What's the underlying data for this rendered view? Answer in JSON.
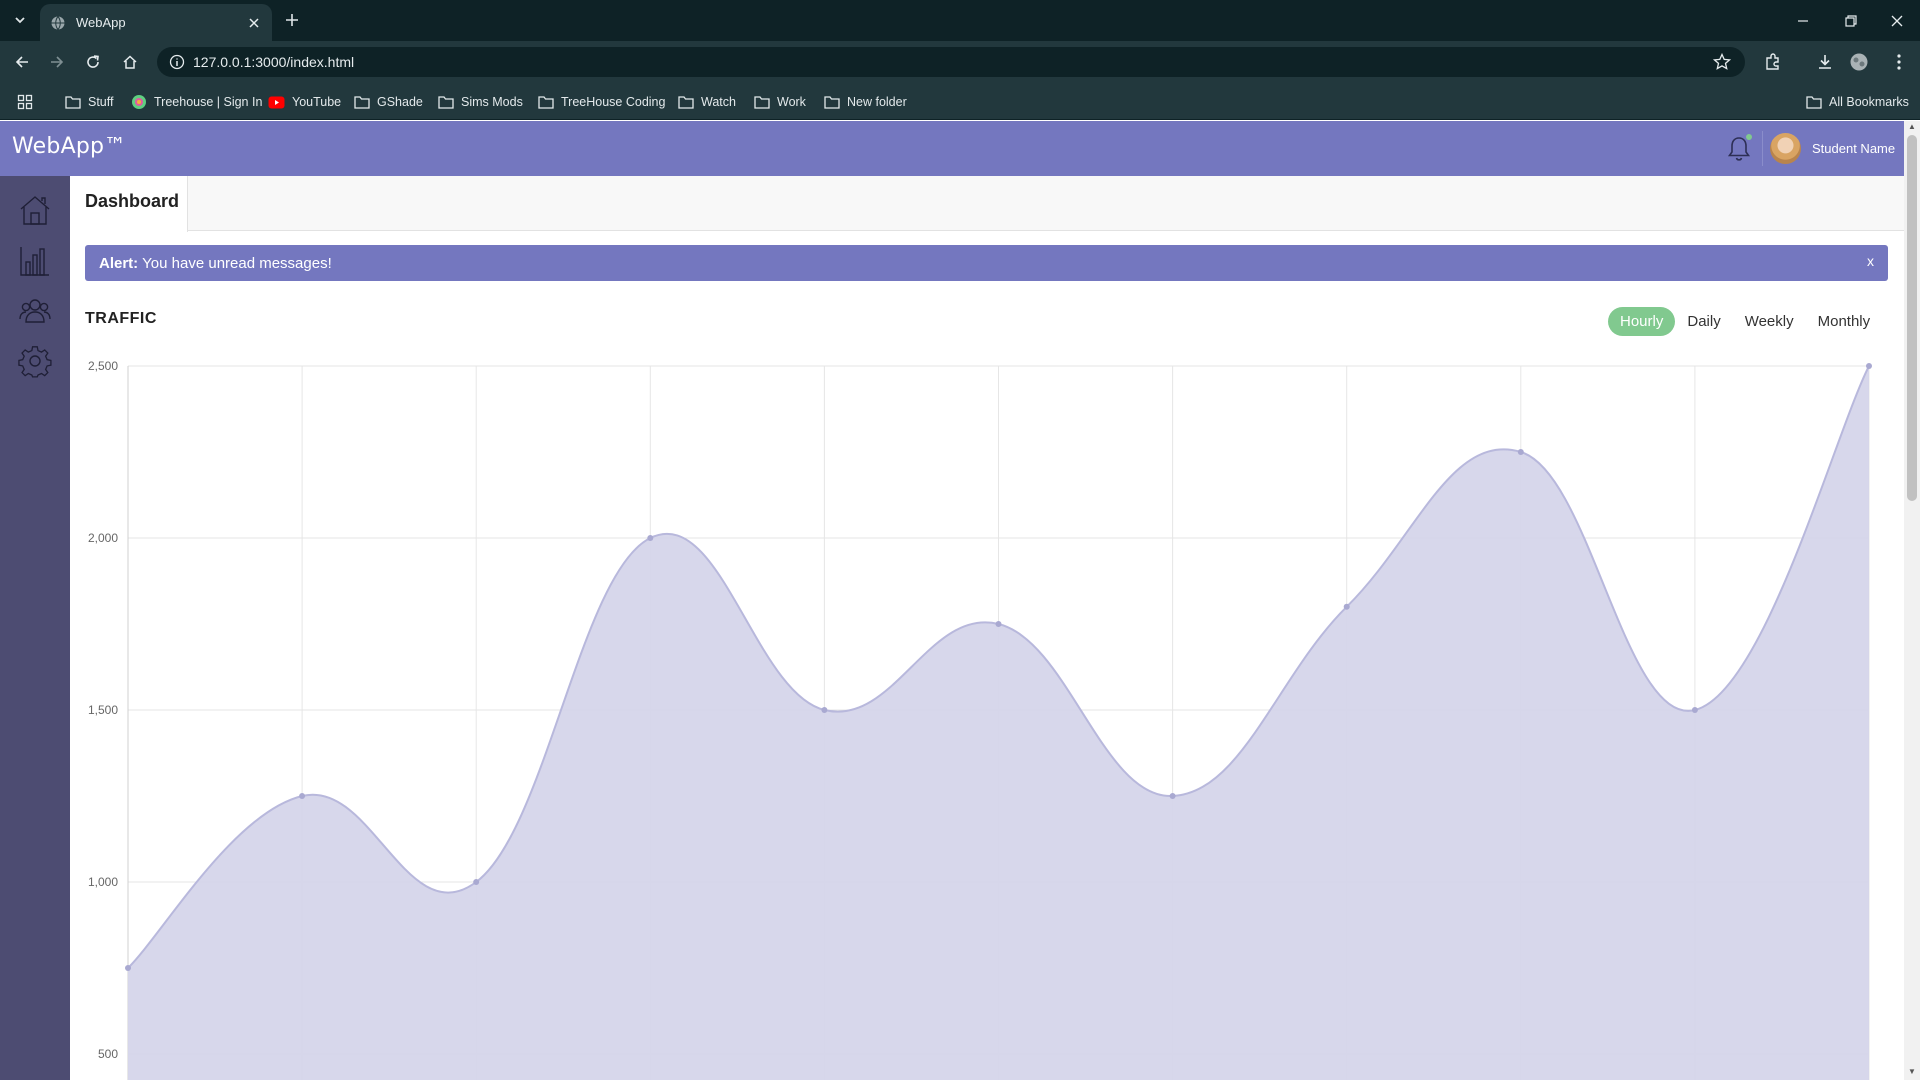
{
  "browser": {
    "tab_title": "WebApp",
    "url": "127.0.0.1:3000/index.html",
    "bookmarks": [
      {
        "label": "Stuff",
        "icon": "folder-icon"
      },
      {
        "label": "Treehouse | Sign In",
        "icon": "treehouse-icon"
      },
      {
        "label": "YouTube",
        "icon": "youtube-icon"
      },
      {
        "label": "GShade",
        "icon": "folder-icon"
      },
      {
        "label": "Sims Mods",
        "icon": "folder-icon"
      },
      {
        "label": "TreeHouse Coding",
        "icon": "folder-icon"
      },
      {
        "label": "Watch",
        "icon": "folder-icon"
      },
      {
        "label": "Work",
        "icon": "folder-icon"
      },
      {
        "label": "New folder",
        "icon": "folder-icon"
      }
    ],
    "all_bookmarks": "All Bookmarks"
  },
  "app": {
    "brand": "WebApp™",
    "user_name": "Student Name",
    "accent_color": "#7477bf",
    "sidebar_color": "#4d4c72",
    "sidebar_icons": [
      "home-icon",
      "bar-chart-icon",
      "members-icon",
      "settings-icon"
    ]
  },
  "dashboard": {
    "tab_label": "Dashboard",
    "alert_label": "Alert:",
    "alert_text": " You have unread messages!",
    "alert_close": "x",
    "traffic_title": "TRAFFIC",
    "filters": [
      {
        "label": "Hourly",
        "active": true
      },
      {
        "label": "Daily",
        "active": false
      },
      {
        "label": "Weekly",
        "active": false
      },
      {
        "label": "Monthly",
        "active": false
      }
    ]
  },
  "chart_data": {
    "type": "area",
    "title": "",
    "xlabel": "",
    "ylabel": "",
    "x": [
      1,
      2,
      3,
      4,
      5,
      6,
      7,
      8,
      9,
      10,
      11
    ],
    "values": [
      750,
      1250,
      1000,
      2000,
      1500,
      1750,
      1250,
      1800,
      2250,
      1500,
      2500
    ],
    "y_ticks": [
      2500,
      2000,
      1500,
      1000,
      500
    ],
    "y_tick_labels": [
      "2,500",
      "2,000",
      "1,500",
      "1,000",
      "500"
    ],
    "ylim": [
      500,
      2500
    ],
    "grid": true,
    "fill_color": "#d5d5ea",
    "line_color": "#b8b8dc",
    "point_color": "#a9a9d1"
  }
}
